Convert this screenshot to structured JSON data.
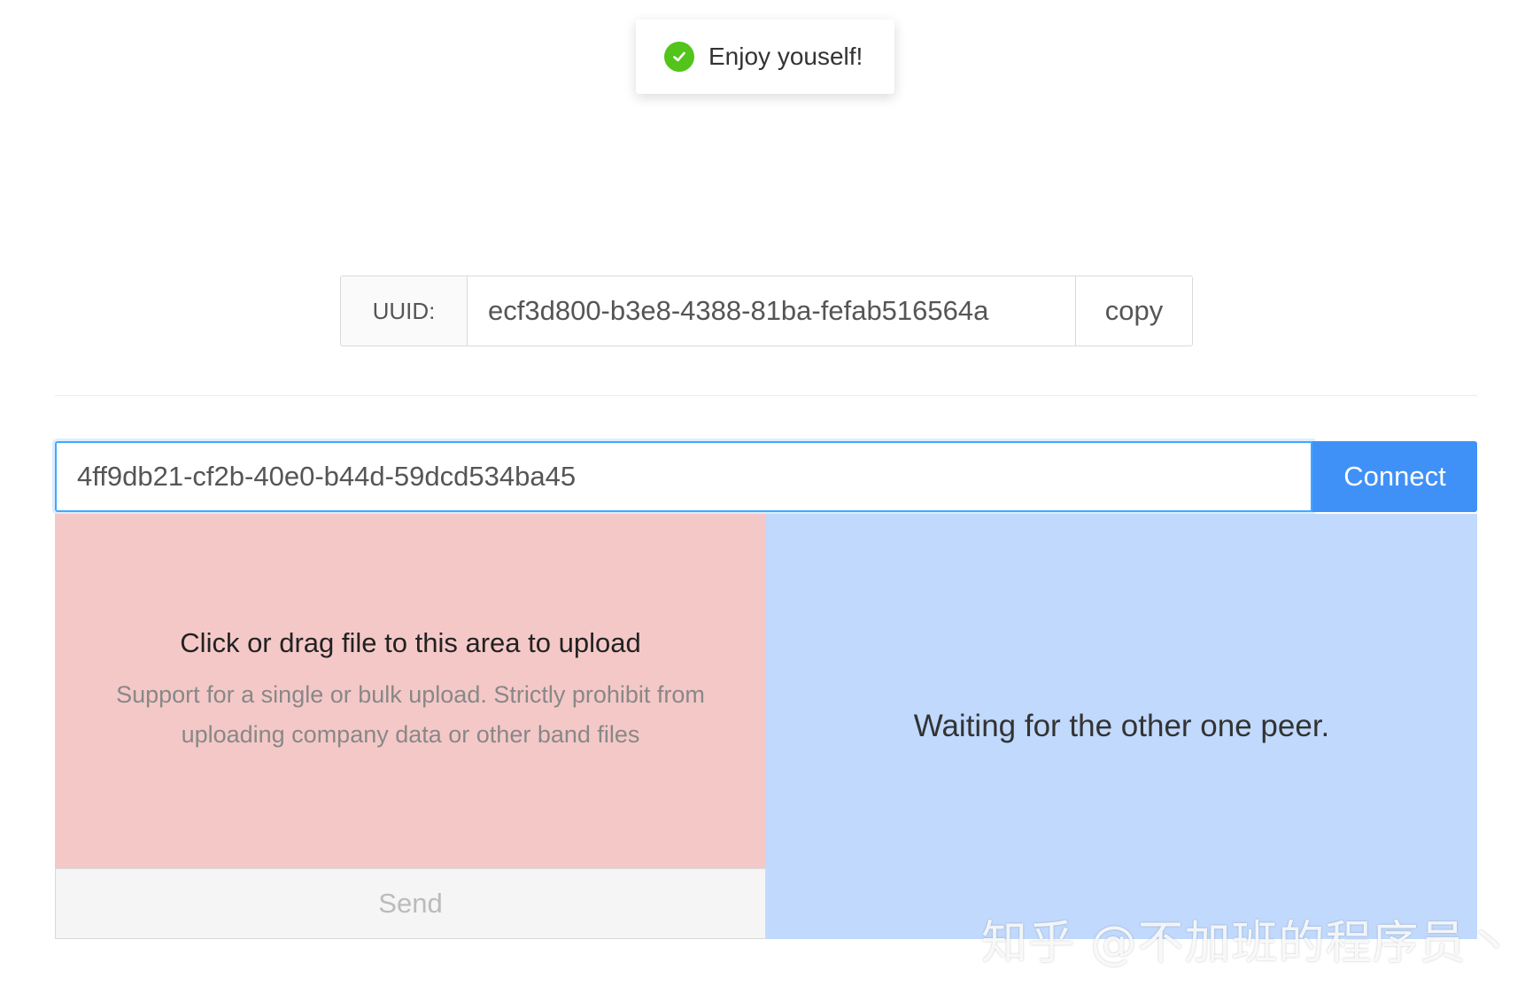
{
  "toast": {
    "message": "Enjoy youself!",
    "icon": "check-circle-icon",
    "icon_color": "#52c41a"
  },
  "uuid": {
    "label": "UUID:",
    "value": "ecf3d800-b3e8-4388-81ba-fefab516564a",
    "copy_label": "copy"
  },
  "connect": {
    "input_value": "4ff9db21-cf2b-40e0-b44d-59dcd534ba45",
    "button_label": "Connect",
    "button_color": "#4091f7"
  },
  "upload": {
    "title": "Click or drag file to this area to upload",
    "hint": "Support for a single or bulk upload. Strictly prohibit from uploading company data or other band files",
    "background_color": "#f5c8c8"
  },
  "send": {
    "label": "Send"
  },
  "peer_panel": {
    "message": "Waiting for the other one peer.",
    "background_color": "#c0d9fd"
  },
  "watermark": {
    "text": "知乎 @不加班的程序员丶"
  }
}
